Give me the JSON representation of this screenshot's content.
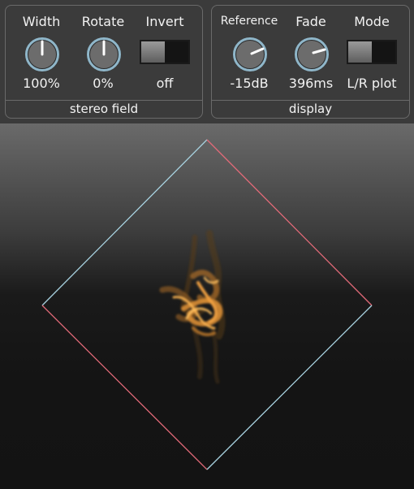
{
  "stereo_field": {
    "title": "stereo field",
    "width": {
      "label": "Width",
      "value": "100%"
    },
    "rotate": {
      "label": "Rotate",
      "value": "0%"
    },
    "invert": {
      "label": "Invert",
      "value": "off"
    }
  },
  "display": {
    "title": "display",
    "reference": {
      "label": "Reference",
      "value": "-15dB"
    },
    "fade": {
      "label": "Fade",
      "value": "396ms"
    },
    "mode": {
      "label": "Mode",
      "value": "L/R plot"
    }
  },
  "colors": {
    "knob_ring": "#8fb6c9",
    "left_channel": "#9fd0e0",
    "right_channel": "#e26a78",
    "signal": "#f0a040"
  }
}
